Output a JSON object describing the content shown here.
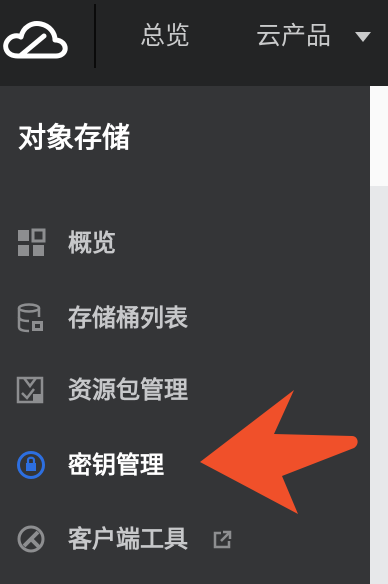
{
  "header": {
    "nav": [
      {
        "label": "总览"
      },
      {
        "label": "云产品",
        "icon": "caret-down-icon"
      }
    ],
    "logo_icon": "cloud-logo-icon"
  },
  "sidebar": {
    "title": "对象存储",
    "items": [
      {
        "label": "概览",
        "icon": "dashboard-grid-icon",
        "active": false
      },
      {
        "label": "存储桶列表",
        "icon": "bucket-database-icon",
        "active": false
      },
      {
        "label": "资源包管理",
        "icon": "resource-package-icon",
        "active": false
      },
      {
        "label": "密钥管理",
        "icon": "key-lock-icon",
        "active": true
      },
      {
        "label": "客户端工具",
        "icon": "client-tool-icon",
        "external_icon": "external-link-icon",
        "active": false
      }
    ]
  },
  "annotation": {
    "icon": "orange-pointer-arrow",
    "color": "#f0502a"
  },
  "colors": {
    "topbar": "#232425",
    "sidebar": "#343537",
    "active_icon": "#2d6fe0",
    "text_muted": "#c7c8ca"
  }
}
